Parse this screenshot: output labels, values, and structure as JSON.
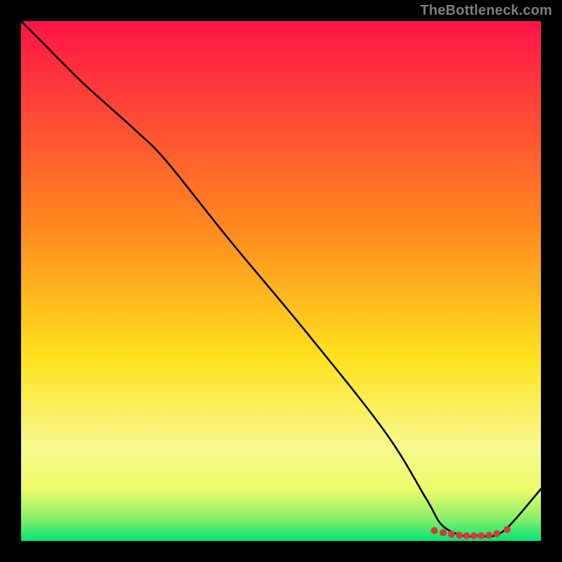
{
  "watermark": "TheBottleneck.com",
  "chart_data": {
    "type": "line",
    "title": "",
    "xlabel": "",
    "ylabel": "",
    "xlim": [
      0,
      100
    ],
    "ylim": [
      0,
      100
    ],
    "gradient_stops": [
      {
        "offset": 0.0,
        "color": "#ff1348"
      },
      {
        "offset": 0.4,
        "color": "#ff8a1e"
      },
      {
        "offset": 0.65,
        "color": "#ffe31e"
      },
      {
        "offset": 0.82,
        "color": "#f7f98f"
      },
      {
        "offset": 0.9,
        "color": "#eefc6a"
      },
      {
        "offset": 0.955,
        "color": "#8df06a"
      },
      {
        "offset": 1.0,
        "color": "#00e676"
      }
    ],
    "series": [
      {
        "name": "curve",
        "x": [
          0,
          4,
          12,
          22,
          28,
          40,
          55,
          70,
          78,
          81,
          85,
          88,
          91,
          94,
          100
        ],
        "y": [
          100,
          96,
          88,
          79,
          73,
          58,
          40,
          21,
          8,
          3,
          1,
          1,
          1,
          3,
          10
        ]
      }
    ],
    "markers": {
      "x": [
        79.5,
        81.2,
        82.8,
        84.3,
        85.7,
        87.1,
        88.5,
        90.0,
        91.5,
        93.5
      ],
      "y": [
        2.0,
        1.6,
        1.3,
        1.1,
        1.0,
        1.0,
        1.0,
        1.1,
        1.4,
        2.2
      ],
      "color": "#d83a3a",
      "radius": 5
    }
  }
}
